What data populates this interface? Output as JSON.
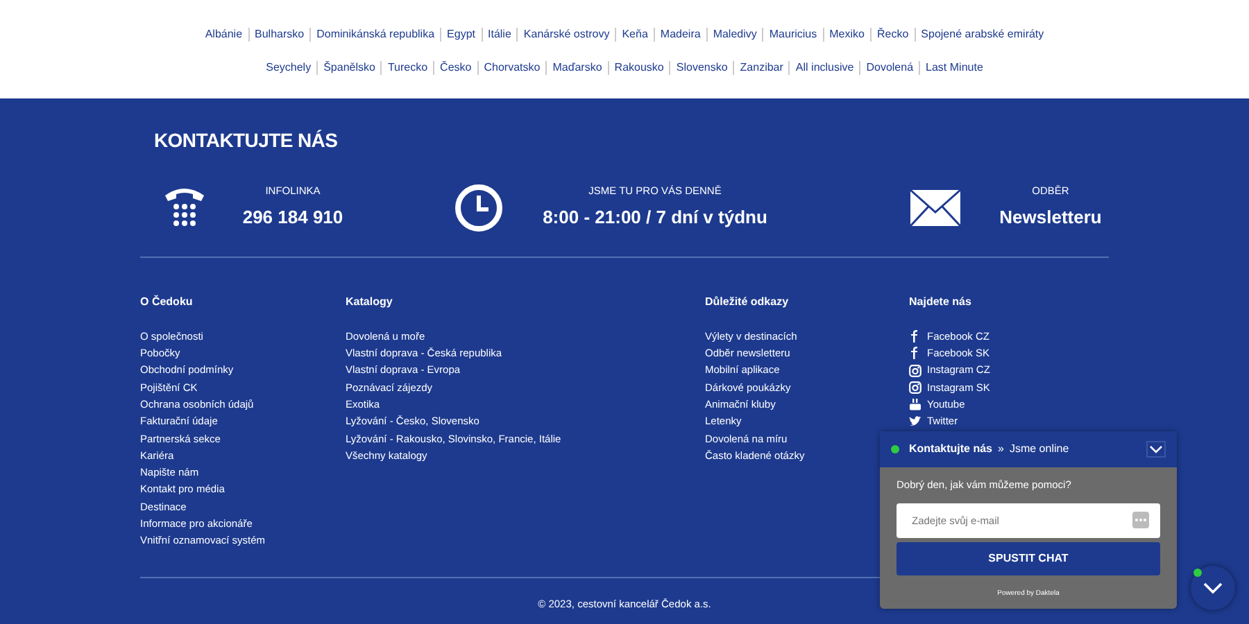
{
  "destinations": [
    [
      "Albánie",
      "Bulharsko",
      "Dominikánská republika",
      "Egypt",
      "Itálie",
      "Kanárské ostrovy",
      "Keňa",
      "Madeira",
      "Maledivy",
      "Mauricius",
      "Mexiko",
      "Řecko",
      "Spojené arabské emiráty"
    ],
    [
      "Seychely",
      "Španělsko",
      "Turecko",
      "Česko",
      "Chorvatsko",
      "Maďarsko",
      "Rakousko",
      "Slovensko",
      "Zanzibar",
      "All inclusive",
      "Dovolená",
      "Last Minute"
    ]
  ],
  "contact": {
    "title": "KONTAKTUJTE NÁS",
    "items": [
      {
        "kind": "phone",
        "label": "INFOLINKA",
        "value": "296 184 910"
      },
      {
        "kind": "clock",
        "label": "JSME TU PRO VÁS DENNĚ",
        "value": "8:00 - 21:00 / 7 dní v týdnu"
      },
      {
        "kind": "mail",
        "label": "ODBĚR",
        "value": "Newsletteru"
      }
    ]
  },
  "columns": [
    {
      "title": "O Čedoku",
      "links": [
        {
          "text": "O společnosti"
        },
        {
          "text": "Pobočky"
        },
        {
          "text": "Obchodní podmínky"
        },
        {
          "text": "Pojištění CK"
        },
        {
          "text": "Ochrana osobních údajů"
        },
        {
          "text": "Fakturační údaje"
        },
        {
          "text": "Partnerská sekce"
        },
        {
          "text": "Kariéra"
        },
        {
          "text": "Napište nám"
        },
        {
          "text": "Kontakt pro média"
        },
        {
          "text": "Destinace"
        },
        {
          "text": "Informace pro akcionáře"
        },
        {
          "text": "Vnitřní oznamovací systém"
        }
      ]
    },
    {
      "title": "Katalogy",
      "links": [
        {
          "text": "Dovolená u moře"
        },
        {
          "text": "Vlastní doprava - Česká republika"
        },
        {
          "text": "Vlastní doprava - Evropa"
        },
        {
          "text": "Poznávací zájezdy"
        },
        {
          "text": "Exotika"
        },
        {
          "text": "Lyžování - Česko, Slovensko"
        },
        {
          "text": "Lyžování - Rakousko, Slovinsko, Francie, Itálie"
        },
        {
          "text": "Všechny katalogy"
        }
      ]
    },
    {
      "title": "Důležité odkazy",
      "links": [
        {
          "text": "Výlety v destinacích"
        },
        {
          "text": "Odběr newsletteru"
        },
        {
          "text": "Mobilní aplikace"
        },
        {
          "text": "Dárkové poukázky"
        },
        {
          "text": "Animační kluby"
        },
        {
          "text": "Letenky"
        },
        {
          "text": "Dovolená na míru"
        },
        {
          "text": "Často kladené otázky"
        }
      ]
    },
    {
      "title": "Najdete nás",
      "links": [
        {
          "text": "Facebook CZ",
          "kind": "fb"
        },
        {
          "text": "Facebook SK",
          "kind": "fb"
        },
        {
          "text": "Instagram CZ",
          "kind": "ig"
        },
        {
          "text": "Instagram SK",
          "kind": "ig"
        },
        {
          "text": "Youtube",
          "kind": "yt"
        },
        {
          "text": "Twitter",
          "kind": "tw"
        }
      ]
    }
  ],
  "copyright": "© 2023, cestovní kancelář Čedok a.s.",
  "chat": {
    "online": true,
    "title": "Kontaktujte nás",
    "separator": "»",
    "status": "Jsme online",
    "greeting": "Dobrý den, jak vám můžeme pomoci?",
    "email_placeholder": "Zadejte svůj e-mail",
    "button": "SPUSTIT CHAT",
    "powered": "Powered by Daktela"
  },
  "chat_toggle": {
    "online": true
  }
}
